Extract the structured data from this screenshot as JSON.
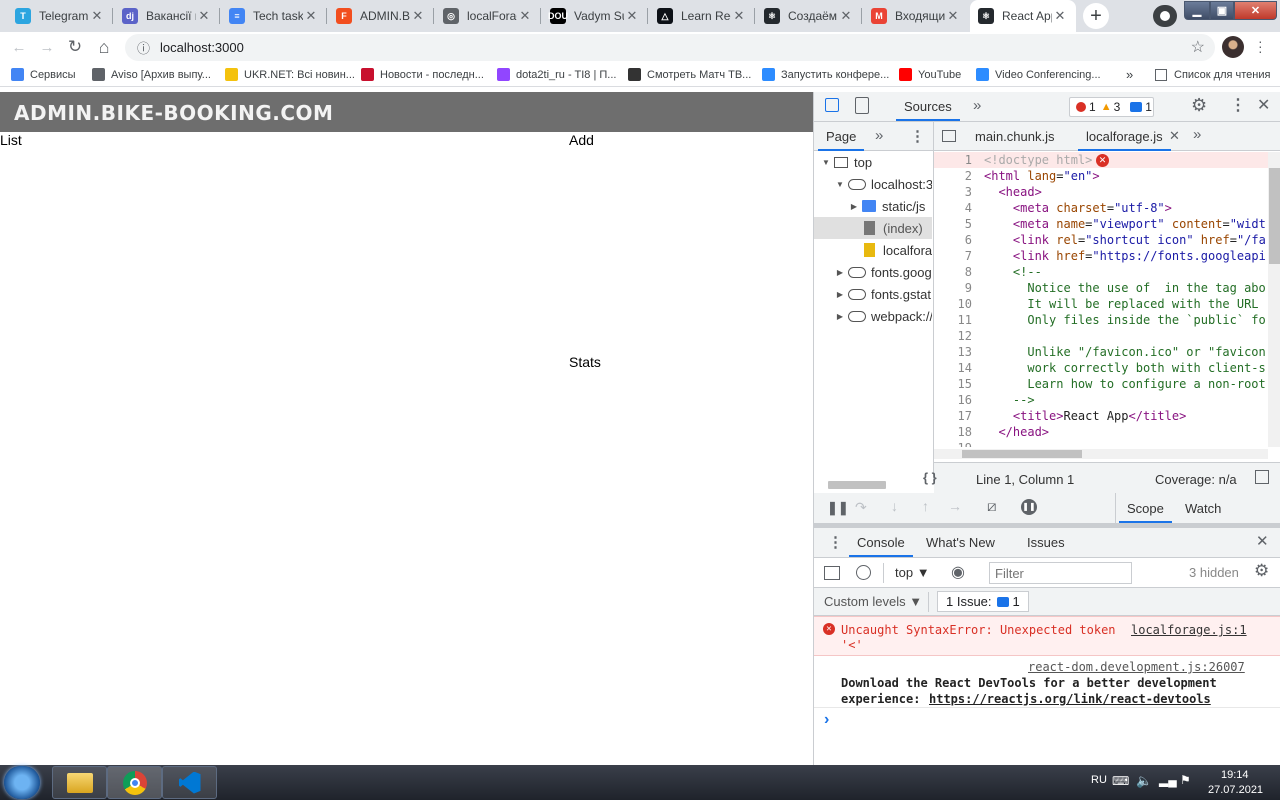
{
  "tabs": [
    {
      "title": "Telegram",
      "fav": "T",
      "color": "#2ca5e0"
    },
    {
      "title": "Вакансії на",
      "fav": "dj",
      "color": "#5b63c8"
    },
    {
      "title": "Tech task",
      "fav": "≡",
      "color": "#4285f4"
    },
    {
      "title": "ADMIN.BI",
      "fav": "F",
      "color": "#f24e1e"
    },
    {
      "title": "localForag",
      "fav": "◎",
      "color": "#5f6368"
    },
    {
      "title": "Vadym Su",
      "fav": "DOU",
      "color": "#000000"
    },
    {
      "title": "Learn Red",
      "fav": "△",
      "color": "#0d1117"
    },
    {
      "title": "Создаём п",
      "fav": "⚛",
      "color": "#24292e"
    },
    {
      "title": "Входящие",
      "fav": "M",
      "color": "#ea4335"
    },
    {
      "title": "React App",
      "fav": "⚛",
      "color": "#24292e"
    }
  ],
  "newtab_symbol": "+",
  "omnibox": {
    "url": "localhost:3000",
    "info_symbol": "ⓘ",
    "star_symbol": "☆"
  },
  "nav": {
    "back": "←",
    "forward": "→",
    "reload": "↻",
    "home": "⌂"
  },
  "bookmarks": [
    {
      "label": "Сервисы",
      "icon": "apps-icon",
      "color": "#4285f4"
    },
    {
      "label": "Aviso [Архив выпу...",
      "icon": "globe-icon",
      "color": "#5f6368"
    },
    {
      "label": "UKR.NET: Всі новин...",
      "icon": "ukrnet-icon",
      "color": "#f4c20d"
    },
    {
      "label": "Новости - последн...",
      "icon": "k-icon",
      "color": "#c8102e"
    },
    {
      "label": "dota2ti_ru - TI8 | П...",
      "icon": "twitch-icon",
      "color": "#9146ff"
    },
    {
      "label": "Смотреть Матч ТВ...",
      "icon": "ball-icon",
      "color": "#333333"
    },
    {
      "label": "Запустить конфере...",
      "icon": "zoom-icon",
      "color": "#2d8cff"
    },
    {
      "label": "YouTube",
      "icon": "youtube-icon",
      "color": "#ff0000"
    },
    {
      "label": "Video Conferencing...",
      "icon": "zoom-icon",
      "color": "#2d8cff"
    }
  ],
  "bookmarks_more": "»",
  "reading_list": "Список для чтения",
  "page": {
    "header_title": "ADMIN.BIKE-BOOKING.COM",
    "list_label": "List",
    "add_label": "Add",
    "stats_label": "Stats"
  },
  "devtools": {
    "main_tab": "Sources",
    "more_tabs": "»",
    "error_count": "1",
    "warning_count": "3",
    "message_count": "1",
    "nav_tab": "Page",
    "editor_tabs": [
      "main.chunk.js",
      "localforage.js"
    ],
    "tree": [
      {
        "label": "top",
        "indent": 0,
        "kind": "frame",
        "open": true
      },
      {
        "label": "localhost:3",
        "indent": 1,
        "kind": "cloud",
        "open": true
      },
      {
        "label": "static/js",
        "indent": 2,
        "kind": "folder",
        "open": false
      },
      {
        "label": "(index)",
        "indent": 2,
        "kind": "file-grey",
        "open": null
      },
      {
        "label": "localfora",
        "indent": 2,
        "kind": "file-yellow",
        "open": null
      },
      {
        "label": "fonts.goog",
        "indent": 1,
        "kind": "cloud",
        "open": false
      },
      {
        "label": "fonts.gstat",
        "indent": 1,
        "kind": "cloud",
        "open": false
      },
      {
        "label": "webpack://",
        "indent": 1,
        "kind": "cloud",
        "open": false
      }
    ],
    "code_lines": [
      {
        "n": "1",
        "html": "<span class=\"doct\">&lt;!doctype html&gt;</span>"
      },
      {
        "n": "2",
        "html": "<span class=\"tag\">&lt;html</span> <span class=\"attr\">lang</span>=<span class=\"val\">\"en\"</span><span class=\"tag\">&gt;</span>"
      },
      {
        "n": "3",
        "html": "  <span class=\"tag\">&lt;head&gt;</span>"
      },
      {
        "n": "4",
        "html": "    <span class=\"tag\">&lt;meta</span> <span class=\"attr\">charset</span>=<span class=\"val\">\"utf-8\"</span><span class=\"tag\">&gt;</span>"
      },
      {
        "n": "5",
        "html": "    <span class=\"tag\">&lt;meta</span> <span class=\"attr\">name</span>=<span class=\"val\">\"viewport\"</span> <span class=\"attr\">content</span>=<span class=\"val\">\"widt</span>"
      },
      {
        "n": "6",
        "html": "    <span class=\"tag\">&lt;link</span> <span class=\"attr\">rel</span>=<span class=\"val\">\"shortcut icon\"</span> <span class=\"attr\">href</span>=<span class=\"val\">\"/fa</span>"
      },
      {
        "n": "7",
        "html": "    <span class=\"tag\">&lt;link</span> <span class=\"attr\">href</span>=<span class=\"val\">\"https://fonts.googleapi</span>"
      },
      {
        "n": "8",
        "html": "    <span class=\"cmt\">&lt;!--</span>"
      },
      {
        "n": "9",
        "html": "<span class=\"cmt\">      Notice the use of  in the tag abo</span>"
      },
      {
        "n": "10",
        "html": "<span class=\"cmt\">      It will be replaced with the URL</span>"
      },
      {
        "n": "11",
        "html": "<span class=\"cmt\">      Only files inside the `public` fo</span>"
      },
      {
        "n": "12",
        "html": ""
      },
      {
        "n": "13",
        "html": "<span class=\"cmt\">      Unlike \"/favicon.ico\" or \"favicon</span>"
      },
      {
        "n": "14",
        "html": "<span class=\"cmt\">      work correctly both with client-s</span>"
      },
      {
        "n": "15",
        "html": "<span class=\"cmt\">      Learn how to configure a non-root</span>"
      },
      {
        "n": "16",
        "html": "<span class=\"cmt\">    --&gt;</span>"
      },
      {
        "n": "17",
        "html": "    <span class=\"tag\">&lt;title&gt;</span>React App<span class=\"tag\">&lt;/title&gt;</span>"
      },
      {
        "n": "18",
        "html": "  <span class=\"tag\">&lt;/head&gt;</span>"
      },
      {
        "n": "19",
        "html": ""
      }
    ],
    "status_left": "Line 1, Column 1",
    "status_right": "Coverage: n/a",
    "status_braces": "{ }",
    "scope_tab": "Scope",
    "watch_tab": "Watch",
    "console_tabs": [
      "Console",
      "What's New",
      "Issues"
    ],
    "context": "top",
    "filter_placeholder": "Filter",
    "hidden": "3 hidden",
    "levels": "Custom levels ▼",
    "issues_label": "1 Issue:",
    "issues_count": "1",
    "error_text_1": "Uncaught SyntaxError: Unexpected token",
    "error_text_2": "'<'",
    "error_source": "localforage.js:1",
    "info_source": "react-dom.development.js:26007",
    "info_text_1": "Download the React DevTools for a better development",
    "info_text_2": "experience:",
    "info_link": "https://reactjs.org/link/react-devtools",
    "prompt": "›"
  },
  "taskbar": {
    "lang": "RU",
    "time": "19:14",
    "date": "27.07.2021"
  },
  "colors": {
    "error": "#d93025",
    "accent": "#1a73e8",
    "header_bg": "#6e6e6e"
  }
}
